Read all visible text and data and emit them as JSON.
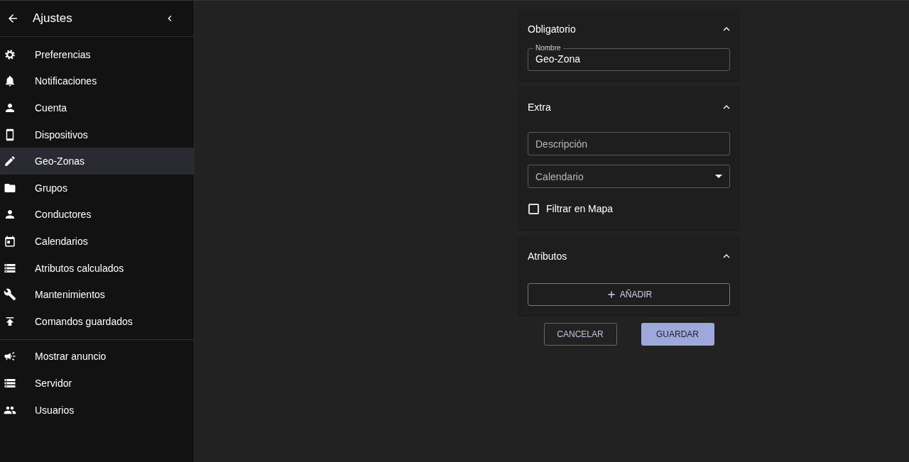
{
  "sidebar": {
    "title": "Ajustes",
    "groups": [
      [
        {
          "label": "Preferencias",
          "selected": false
        },
        {
          "label": "Notificaciones",
          "selected": false
        },
        {
          "label": "Cuenta",
          "selected": false
        },
        {
          "label": "Dispositivos",
          "selected": false
        },
        {
          "label": "Geo-Zonas",
          "selected": true
        },
        {
          "label": "Grupos",
          "selected": false
        },
        {
          "label": "Conductores",
          "selected": false
        },
        {
          "label": "Calendarios",
          "selected": false
        },
        {
          "label": "Atributos calculados",
          "selected": false
        },
        {
          "label": "Mantenimientos",
          "selected": false
        },
        {
          "label": "Comandos guardados",
          "selected": false
        }
      ],
      [
        {
          "label": "Mostrar anuncio",
          "selected": false
        },
        {
          "label": "Servidor",
          "selected": false
        },
        {
          "label": "Usuarios",
          "selected": false
        }
      ]
    ]
  },
  "form": {
    "sections": [
      {
        "title": "Obligatorio",
        "expanded": true,
        "fields": [
          {
            "kind": "text",
            "label": "Nombre",
            "value": "Geo-Zona"
          }
        ]
      },
      {
        "title": "Extra",
        "expanded": true,
        "fields": [
          {
            "kind": "text",
            "placeholder": "Descripción"
          },
          {
            "kind": "select",
            "placeholder": "Calendario"
          },
          {
            "kind": "checkbox",
            "label": "Filtrar en Mapa",
            "checked": false
          }
        ]
      },
      {
        "title": "Atributos",
        "expanded": true,
        "fields": [
          {
            "kind": "add",
            "label": "AÑADIR"
          }
        ]
      }
    ]
  },
  "buttons": [
    {
      "label": "CANCELAR",
      "kind": "outlined"
    },
    {
      "label": "GUARDAR",
      "kind": "contained"
    }
  ]
}
